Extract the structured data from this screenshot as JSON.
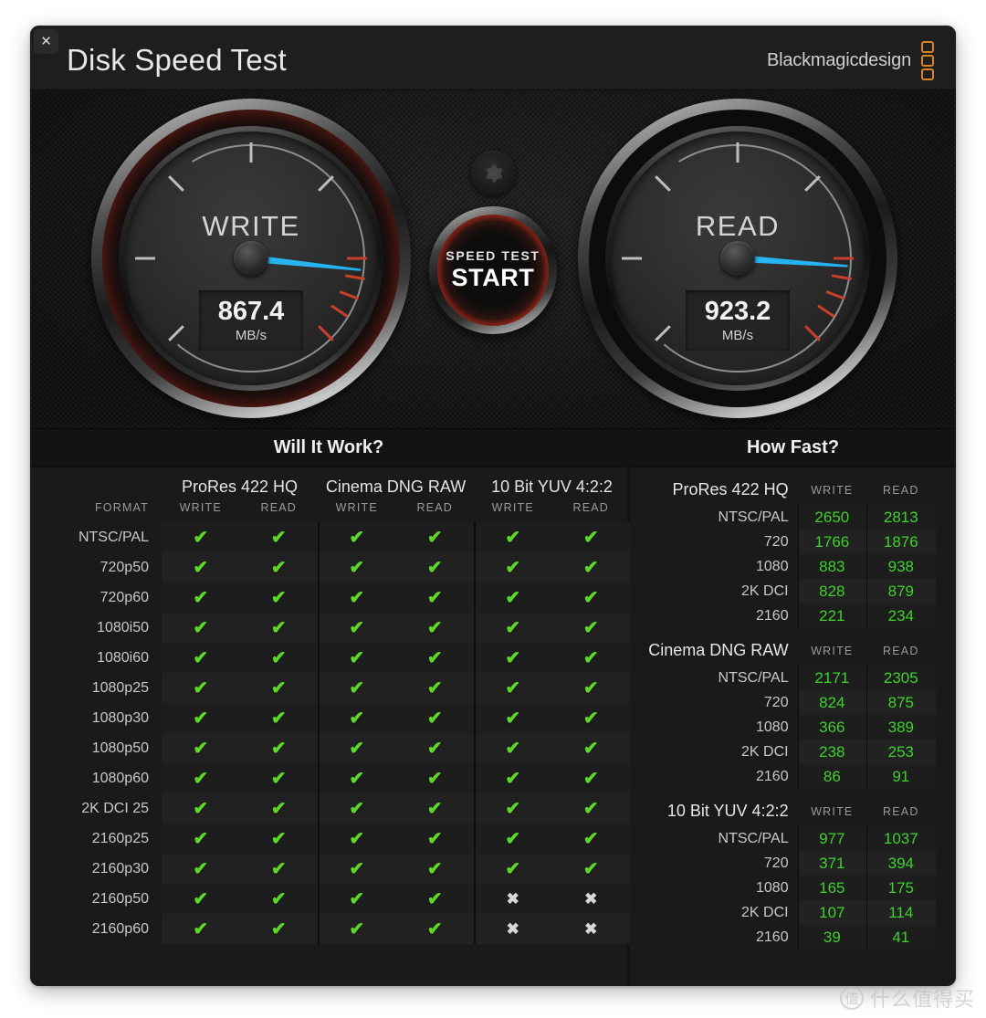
{
  "window": {
    "title": "Disk Speed Test",
    "brand": "Blackmagicdesign",
    "close_label": "✕"
  },
  "gauges": {
    "write": {
      "label": "WRITE",
      "value": "867.4",
      "unit": "MB/s",
      "needle_angle_deg": 186
    },
    "read": {
      "label": "READ",
      "value": "923.2",
      "unit": "MB/s",
      "needle_angle_deg": 184
    }
  },
  "center": {
    "settings_icon": "gear-icon",
    "start_small": "SPEED TEST",
    "start_big": "START"
  },
  "will_it_work": {
    "title": "Will It Work?",
    "format_header": "FORMAT",
    "groups": [
      "ProRes 422 HQ",
      "Cinema DNG RAW",
      "10 Bit YUV 4:2:2"
    ],
    "sub_headers": [
      "WRITE",
      "READ"
    ],
    "tick_glyph": "✔",
    "cross_glyph": "✖",
    "rows": [
      {
        "format": "NTSC/PAL",
        "cells": [
          true,
          true,
          true,
          true,
          true,
          true
        ]
      },
      {
        "format": "720p50",
        "cells": [
          true,
          true,
          true,
          true,
          true,
          true
        ]
      },
      {
        "format": "720p60",
        "cells": [
          true,
          true,
          true,
          true,
          true,
          true
        ]
      },
      {
        "format": "1080i50",
        "cells": [
          true,
          true,
          true,
          true,
          true,
          true
        ]
      },
      {
        "format": "1080i60",
        "cells": [
          true,
          true,
          true,
          true,
          true,
          true
        ]
      },
      {
        "format": "1080p25",
        "cells": [
          true,
          true,
          true,
          true,
          true,
          true
        ]
      },
      {
        "format": "1080p30",
        "cells": [
          true,
          true,
          true,
          true,
          true,
          true
        ]
      },
      {
        "format": "1080p50",
        "cells": [
          true,
          true,
          true,
          true,
          true,
          true
        ]
      },
      {
        "format": "1080p60",
        "cells": [
          true,
          true,
          true,
          true,
          true,
          true
        ]
      },
      {
        "format": "2K DCI 25",
        "cells": [
          true,
          true,
          true,
          true,
          true,
          true
        ]
      },
      {
        "format": "2160p25",
        "cells": [
          true,
          true,
          true,
          true,
          true,
          true
        ]
      },
      {
        "format": "2160p30",
        "cells": [
          true,
          true,
          true,
          true,
          true,
          true
        ]
      },
      {
        "format": "2160p50",
        "cells": [
          true,
          true,
          true,
          true,
          false,
          false
        ]
      },
      {
        "format": "2160p60",
        "cells": [
          true,
          true,
          true,
          true,
          false,
          false
        ]
      }
    ]
  },
  "how_fast": {
    "title": "How Fast?",
    "col_write": "WRITE",
    "col_read": "READ",
    "groups": [
      {
        "name": "ProRes 422 HQ",
        "rows": [
          {
            "label": "NTSC/PAL",
            "write": "2650",
            "read": "2813"
          },
          {
            "label": "720",
            "write": "1766",
            "read": "1876"
          },
          {
            "label": "1080",
            "write": "883",
            "read": "938"
          },
          {
            "label": "2K DCI",
            "write": "828",
            "read": "879"
          },
          {
            "label": "2160",
            "write": "221",
            "read": "234"
          }
        ]
      },
      {
        "name": "Cinema DNG RAW",
        "rows": [
          {
            "label": "NTSC/PAL",
            "write": "2171",
            "read": "2305"
          },
          {
            "label": "720",
            "write": "824",
            "read": "875"
          },
          {
            "label": "1080",
            "write": "366",
            "read": "389"
          },
          {
            "label": "2K DCI",
            "write": "238",
            "read": "253"
          },
          {
            "label": "2160",
            "write": "86",
            "read": "91"
          }
        ]
      },
      {
        "name": "10 Bit YUV 4:2:2",
        "rows": [
          {
            "label": "NTSC/PAL",
            "write": "977",
            "read": "1037"
          },
          {
            "label": "720",
            "write": "371",
            "read": "394"
          },
          {
            "label": "1080",
            "write": "165",
            "read": "175"
          },
          {
            "label": "2K DCI",
            "write": "107",
            "read": "114"
          },
          {
            "label": "2160",
            "write": "39",
            "read": "41"
          }
        ]
      }
    ]
  },
  "watermark": {
    "logo": "值",
    "text": "什么值得买"
  },
  "colors": {
    "accent_red": "#c82a18",
    "needle_blue": "#27b8f3",
    "tick_green": "#5ed62a",
    "value_green": "#3fd12c",
    "brand_orange": "#d98327"
  }
}
